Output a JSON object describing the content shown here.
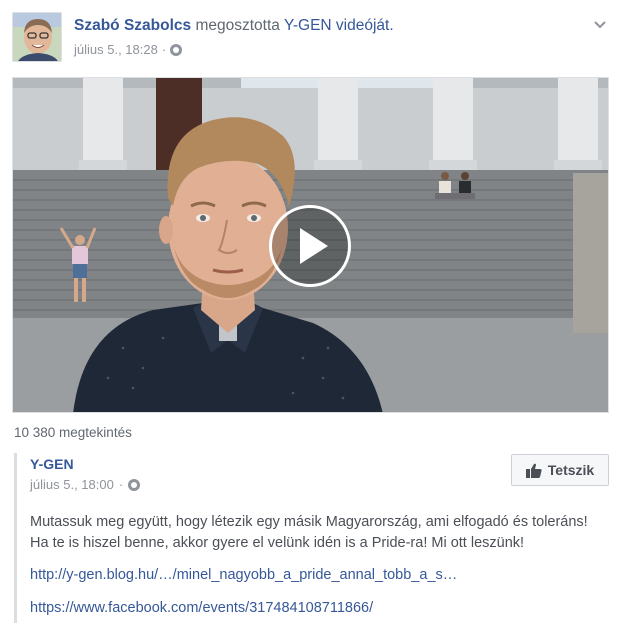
{
  "post": {
    "author": "Szabó Szabolcs",
    "action": "megosztotta",
    "page": "Y-GEN",
    "object": "videóját.",
    "date": "július 5., 18:28",
    "separator": "·"
  },
  "video": {
    "views": "10 380 megtekintés"
  },
  "shared": {
    "page_name": "Y-GEN",
    "date": "július 5., 18:00",
    "separator": "·",
    "like_label": "Tetszik",
    "text": "Mutassuk meg együtt, hogy létezik egy másik Magyarország, ami elfogadó és toleráns! Ha te is hiszel benne, akkor gyere el velünk idén is a Pride-ra! Mi ott leszünk!",
    "link1": "http://y-gen.blog.hu/…/minel_nagyobb_a_pride_annal_tobb_a_s…",
    "link2": "https://www.facebook.com/events/317484108711866/"
  },
  "icons": {
    "privacy": "globe-icon",
    "menu": "chevron-down-icon",
    "play": "play-icon",
    "like": "thumbs-up-icon"
  },
  "colors": {
    "link": "#365899",
    "meta": "#90949c",
    "body_text": "#4b4f56",
    "border": "#dadde1"
  }
}
